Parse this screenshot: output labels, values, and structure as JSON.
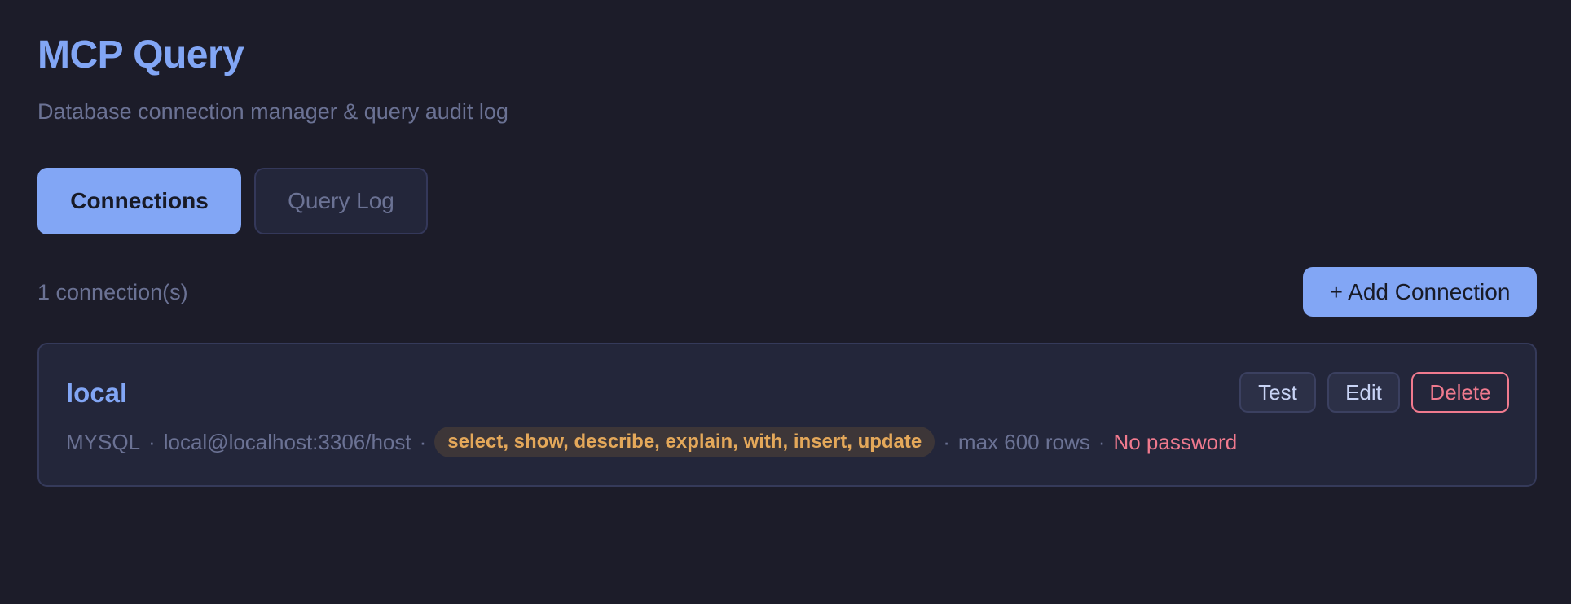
{
  "app": {
    "title": "MCP Query",
    "subtitle": "Database connection manager & query audit log"
  },
  "tabs": [
    {
      "label": "Connections",
      "active": true
    },
    {
      "label": "Query Log",
      "active": false
    }
  ],
  "toolbar": {
    "count_label": "1 connection(s)",
    "add_button_label": "+ Add Connection"
  },
  "connections": [
    {
      "name": "local",
      "actions": {
        "test_label": "Test",
        "edit_label": "Edit",
        "delete_label": "Delete"
      },
      "meta": {
        "type": "MYSQL",
        "separator": "·",
        "address": "local@localhost:3306/host",
        "permissions": "select, show, describe, explain, with, insert, update",
        "max_rows": "max 600 rows",
        "password_status": "No password"
      }
    }
  ],
  "colors": {
    "background": "#1c1c29",
    "accent": "#82a6f5",
    "muted_text": "#6b7294",
    "danger": "#f07a8e",
    "warning": "#e4a85a"
  }
}
